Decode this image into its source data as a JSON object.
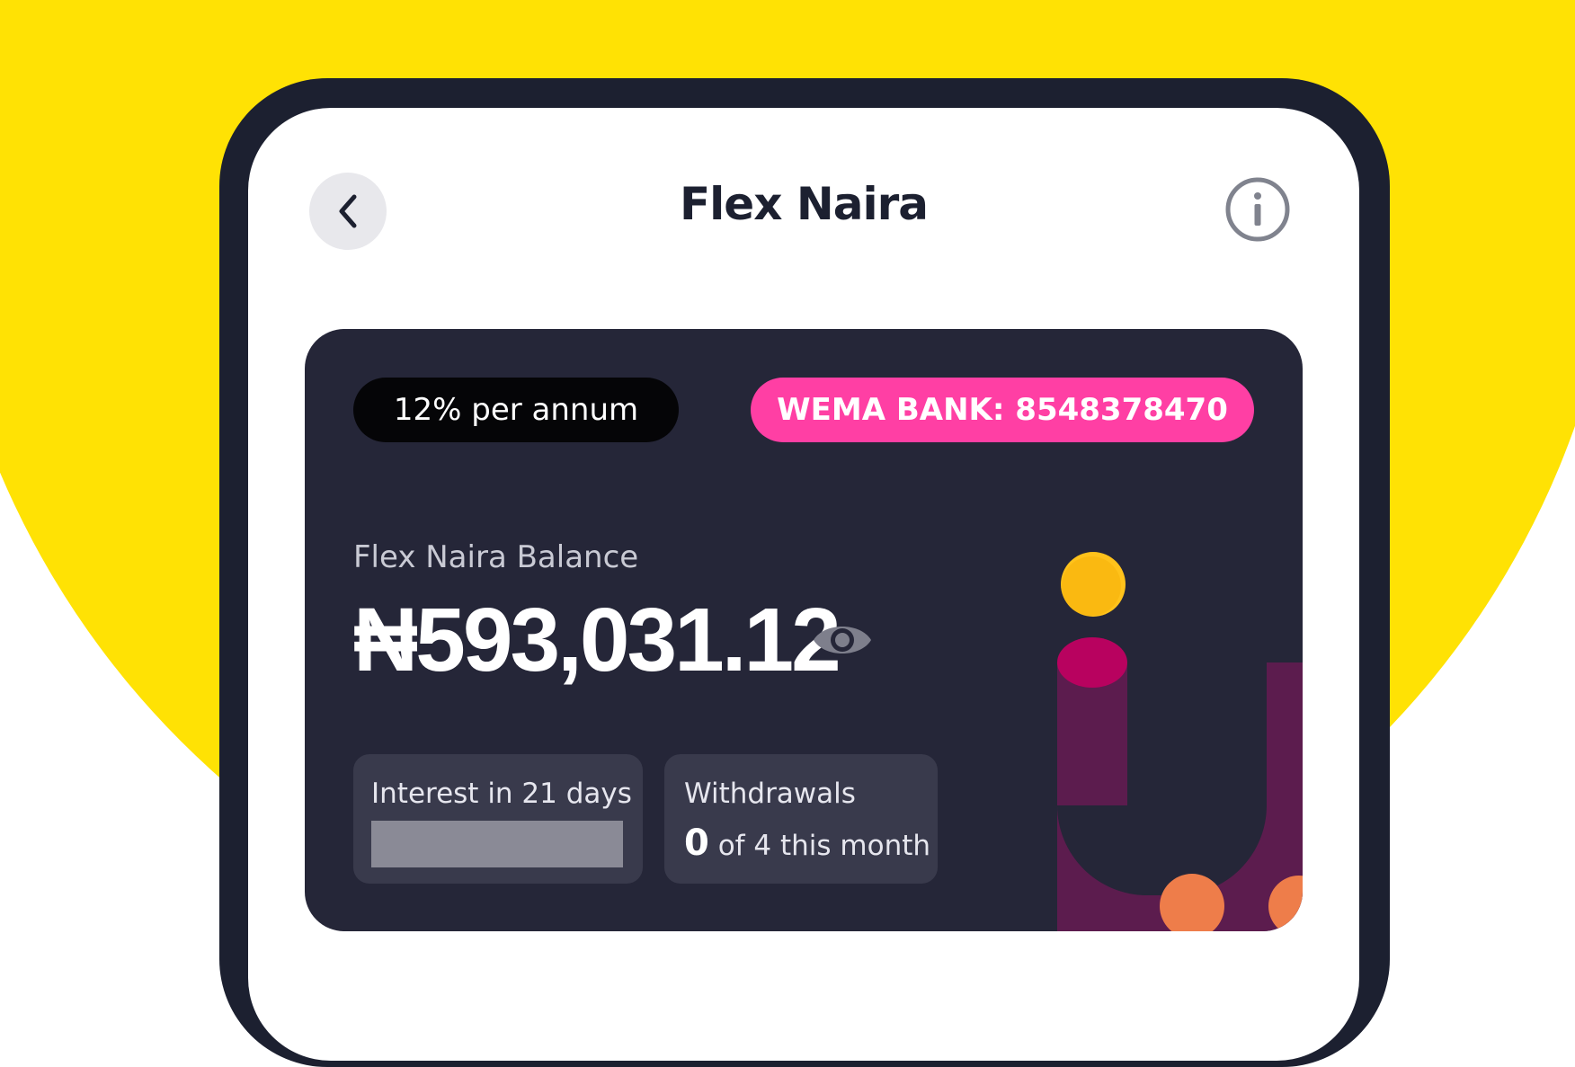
{
  "header": {
    "title": "Flex Naira",
    "back_icon": "chevron-left-icon",
    "info_icon": "info-circle-icon"
  },
  "card": {
    "rate_label": "12% per annum",
    "bank_label": "WEMA BANK: 8548378470",
    "balance_label": "Flex Naira Balance",
    "balance_amount": "₦593,031.12",
    "eye_icon": "eye-icon",
    "interest_label": "Interest in 21 days",
    "withdrawals_label": "Withdrawals",
    "withdrawals_count": "0",
    "withdrawals_suffix": " of 4 this month"
  },
  "colors": {
    "background_accent": "#FFE204",
    "phone_frame": "#1C2030",
    "card_background": "#252638",
    "bank_pill": "#FF3FA4",
    "rate_pill": "#050507"
  }
}
